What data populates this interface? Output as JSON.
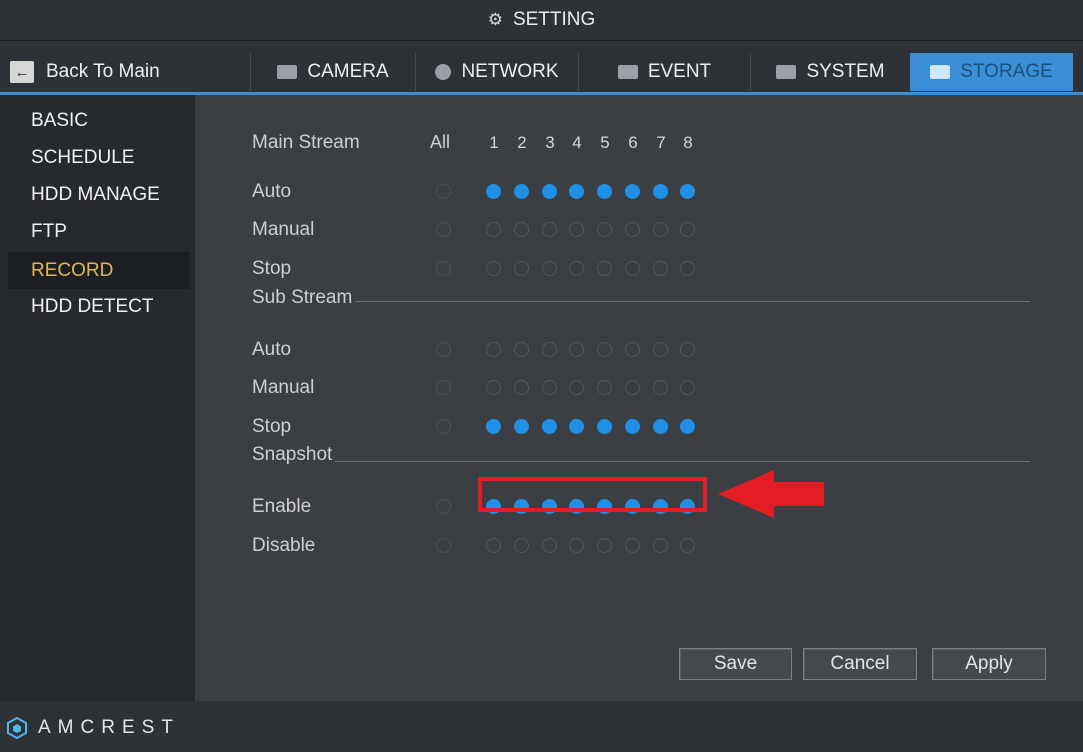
{
  "title": {
    "icon": "gear-icon",
    "text": "SETTING"
  },
  "back": {
    "icon": "back-arrow-icon",
    "label": "Back To Main"
  },
  "tabs": [
    {
      "label": "CAMERA",
      "icon": "camera-icon"
    },
    {
      "label": "NETWORK",
      "icon": "globe-icon"
    },
    {
      "label": "EVENT",
      "icon": "event-icon"
    },
    {
      "label": "SYSTEM",
      "icon": "system-icon"
    },
    {
      "label": "STORAGE",
      "icon": "monitor-icon",
      "active": true
    }
  ],
  "sidebar": {
    "items": [
      {
        "label": "BASIC"
      },
      {
        "label": "SCHEDULE"
      },
      {
        "label": "HDD MANAGE"
      },
      {
        "label": "FTP"
      },
      {
        "label": "RECORD",
        "active": true
      },
      {
        "label": "HDD DETECT"
      }
    ]
  },
  "record": {
    "main_stream_label": "Main Stream",
    "all_label": "All",
    "channels": [
      "1",
      "2",
      "3",
      "4",
      "5",
      "6",
      "7",
      "8"
    ],
    "main_rows": [
      {
        "label": "Auto",
        "all": false,
        "values": [
          true,
          true,
          true,
          true,
          true,
          true,
          true,
          true
        ]
      },
      {
        "label": "Manual",
        "all": false,
        "values": [
          false,
          false,
          false,
          false,
          false,
          false,
          false,
          false
        ]
      },
      {
        "label": "Stop",
        "all": false,
        "values": [
          false,
          false,
          false,
          false,
          false,
          false,
          false,
          false
        ]
      }
    ],
    "sub_stream_label": "Sub Stream",
    "sub_rows": [
      {
        "label": "Auto",
        "all": false,
        "values": [
          false,
          false,
          false,
          false,
          false,
          false,
          false,
          false
        ]
      },
      {
        "label": "Manual",
        "all": false,
        "values": [
          false,
          false,
          false,
          false,
          false,
          false,
          false,
          false
        ]
      },
      {
        "label": "Stop",
        "all": false,
        "values": [
          true,
          true,
          true,
          true,
          true,
          true,
          true,
          true
        ]
      }
    ],
    "snapshot_label": "Snapshot",
    "snapshot_rows": [
      {
        "label": "Enable",
        "all": false,
        "values": [
          true,
          true,
          true,
          true,
          true,
          true,
          true,
          true
        ]
      },
      {
        "label": "Disable",
        "all": false,
        "values": [
          false,
          false,
          false,
          false,
          false,
          false,
          false,
          false
        ]
      }
    ]
  },
  "buttons": {
    "save": "Save",
    "cancel": "Cancel",
    "apply": "Apply"
  },
  "brand": {
    "logo": "AMCREST"
  },
  "colors": {
    "accent": "#3a8fd6",
    "radio_on": "#1f90e6",
    "active_side": "#e5b64e",
    "highlight": "#e21d24"
  }
}
